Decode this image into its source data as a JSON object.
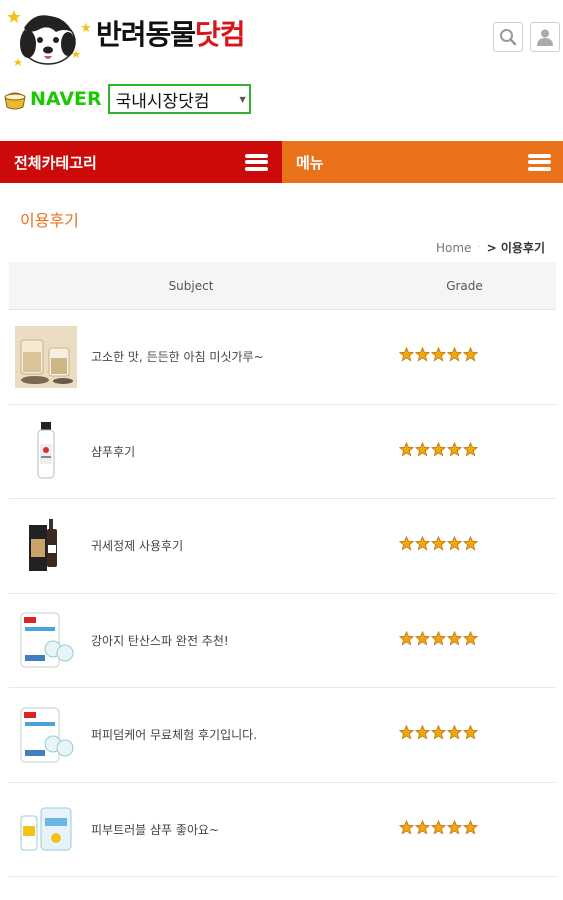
{
  "header": {
    "logo_text_black": "반려동물",
    "logo_text_red": "닷컴",
    "search_icon": "search-icon",
    "user_icon": "user-icon"
  },
  "market": {
    "naver_label": "NAVER",
    "selected": "국내시장닷컴"
  },
  "nav": {
    "category_label": "전체카테고리",
    "menu_label": "메뉴"
  },
  "page": {
    "title": "이용후기",
    "breadcrumb_home": "Home",
    "breadcrumb_current": "> 이용후기"
  },
  "table": {
    "col_subject": "Subject",
    "col_grade": "Grade",
    "rows": [
      {
        "subject": "고소한 맛, 든든한 아침 미싯가루~",
        "rating": 5,
        "thumb": "grain-drink"
      },
      {
        "subject": "샴푸후기",
        "rating": 5,
        "thumb": "shampoo-bottle"
      },
      {
        "subject": "귀세정제 사용후기",
        "rating": 5,
        "thumb": "ear-cleaner"
      },
      {
        "subject": "강아지 탄산스파 완전 추천!",
        "rating": 5,
        "thumb": "spa-pack"
      },
      {
        "subject": "퍼피덤케어 무료체험 후기입니다.",
        "rating": 5,
        "thumb": "spa-pack"
      },
      {
        "subject": "피부트러블 샴푸 좋아요~",
        "rating": 5,
        "thumb": "shampoo-set"
      }
    ]
  },
  "colors": {
    "category_bar": "#cc0a0a",
    "menu_bar": "#e8711a",
    "naver_green": "#1ec800",
    "star": "#f2a413"
  }
}
